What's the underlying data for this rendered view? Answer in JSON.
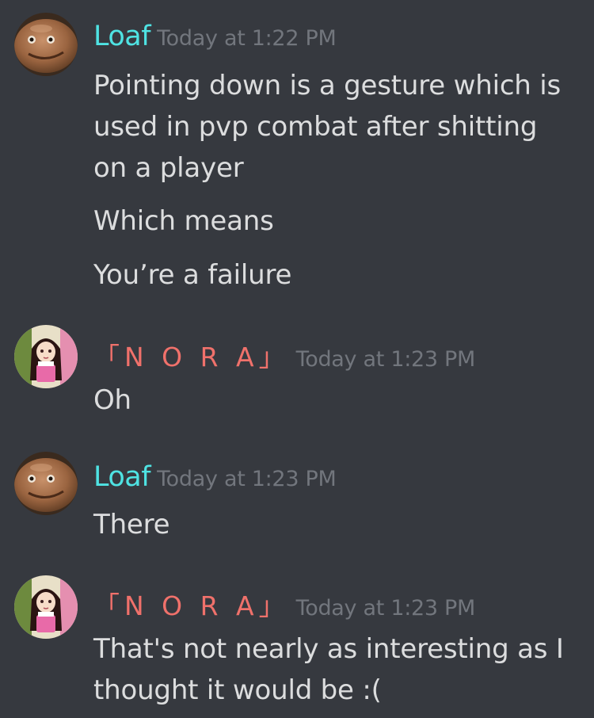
{
  "messages": [
    {
      "author": "Loaf",
      "timestamp": "Today at 1:22 PM",
      "lines": [
        "Pointing down is a gesture which is used in pvp combat after shitting on a player",
        "Which means",
        "You’re a failure"
      ]
    },
    {
      "author": "「N O R A」",
      "timestamp": "Today at 1:23 PM",
      "lines": [
        "Oh"
      ]
    },
    {
      "author": "Loaf",
      "timestamp": "Today at 1:23 PM",
      "lines": [
        "There"
      ]
    },
    {
      "author": "「N O R A」",
      "timestamp": "Today at 1:23 PM",
      "lines": [
        "That's not nearly as interesting as I thought it would be :("
      ]
    }
  ],
  "colors": {
    "background": "#36393f",
    "loaf_name": "#4fe3e3",
    "nora_name": "#f0716b",
    "timestamp": "#72767d",
    "text": "#dcddde"
  }
}
